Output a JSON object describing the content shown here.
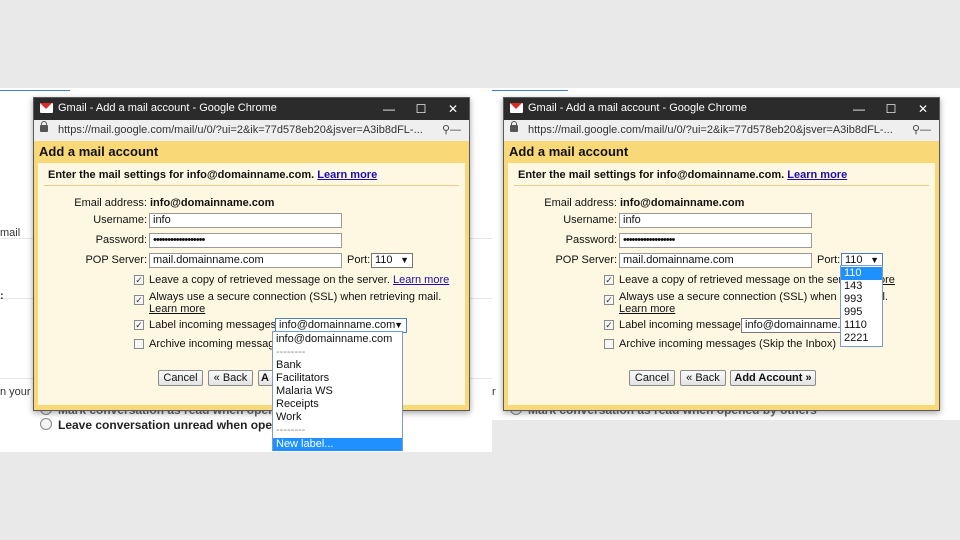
{
  "left_window": {
    "title": "Gmail - Add a mail account - Google Chrome",
    "url": "https://mail.google.com/mail/u/0/?ui=2&ik=77d578eb20&jsver=A3ib8dFL-...",
    "dialog_title": "Add a mail account",
    "intro": "Enter the mail settings for info@domainname.com.",
    "intro_link": "Learn more",
    "email_label": "Email address:",
    "email_value": "info@domainname.com",
    "username_label": "Username:",
    "username_value": "info",
    "password_label": "Password:",
    "password_value": "••••••••••••••••••",
    "pop_label": "POP Server:",
    "pop_value": "mail.domainname.com",
    "port_label": "Port:",
    "port_value": "110",
    "leave_copy": "Leave a copy of retrieved message on the server.",
    "leave_copy_link": "Learn more",
    "ssl": "Always use a secure connection (SSL) when retrieving mail.",
    "ssl_link": "Learn more",
    "label_incoming": "Label incoming messages:",
    "label_value": "info@domainname.com",
    "archive": "Archive incoming messages",
    "cancel": "Cancel",
    "back": "« Back",
    "add_account_partial": "A",
    "label_options": [
      "info@domainname.com",
      "--------",
      "Bank",
      "Facilitators",
      "Malaria WS",
      "Receipts",
      "Work",
      "--------",
      "New label..."
    ]
  },
  "right_window": {
    "title": "Gmail - Add a mail account - Google Chrome",
    "url": "https://mail.google.com/mail/u/0/?ui=2&ik=77d578eb20&jsver=A3ib8dFL-...",
    "dialog_title": "Add a mail account",
    "intro": "Enter the mail settings for info@domainname.com.",
    "intro_link": "Learn more",
    "email_label": "Email address:",
    "email_value": "info@domainname.com",
    "username_label": "Username:",
    "username_value": "info",
    "password_label": "Password:",
    "password_value": "••••••••••••••••••",
    "pop_label": "POP Server:",
    "pop_value": "mail.domainname.com",
    "port_label": "Port:",
    "port_value": "110",
    "leave_copy": "Leave a copy of retrieved message on the server.",
    "leave_copy_link": "ore",
    "ssl": "Always use a secure connection (SSL) when retri",
    "ssl_tail": "il.",
    "ssl_link": "Learn more",
    "label_incoming": "Label incoming messages:",
    "label_value": "info@domainname.c",
    "archive": "Archive incoming messages (Skip the Inbox)",
    "cancel": "Cancel",
    "back": "« Back",
    "add_account": "Add Account »",
    "port_options": [
      "110",
      "143",
      "993",
      "995",
      "1110",
      "2221"
    ]
  },
  "background": {
    "left_partial_mail": "mail",
    "left_partial_colon": ":",
    "left_partial_on_your": "n your",
    "left_mark_read": "Mark conversation as read when opened by others",
    "left_leave_unread": "Leave conversation unread when opened by others",
    "right_partial": "r",
    "right_mark_read": "Mark conversation as read when opened by others"
  },
  "colors": {
    "dialog_yellow": "#f8d877",
    "panel_cream": "#fef7e1",
    "titlebar": "#2b2b2b",
    "link": "#1a0dab",
    "selection": "#1e90ff"
  }
}
